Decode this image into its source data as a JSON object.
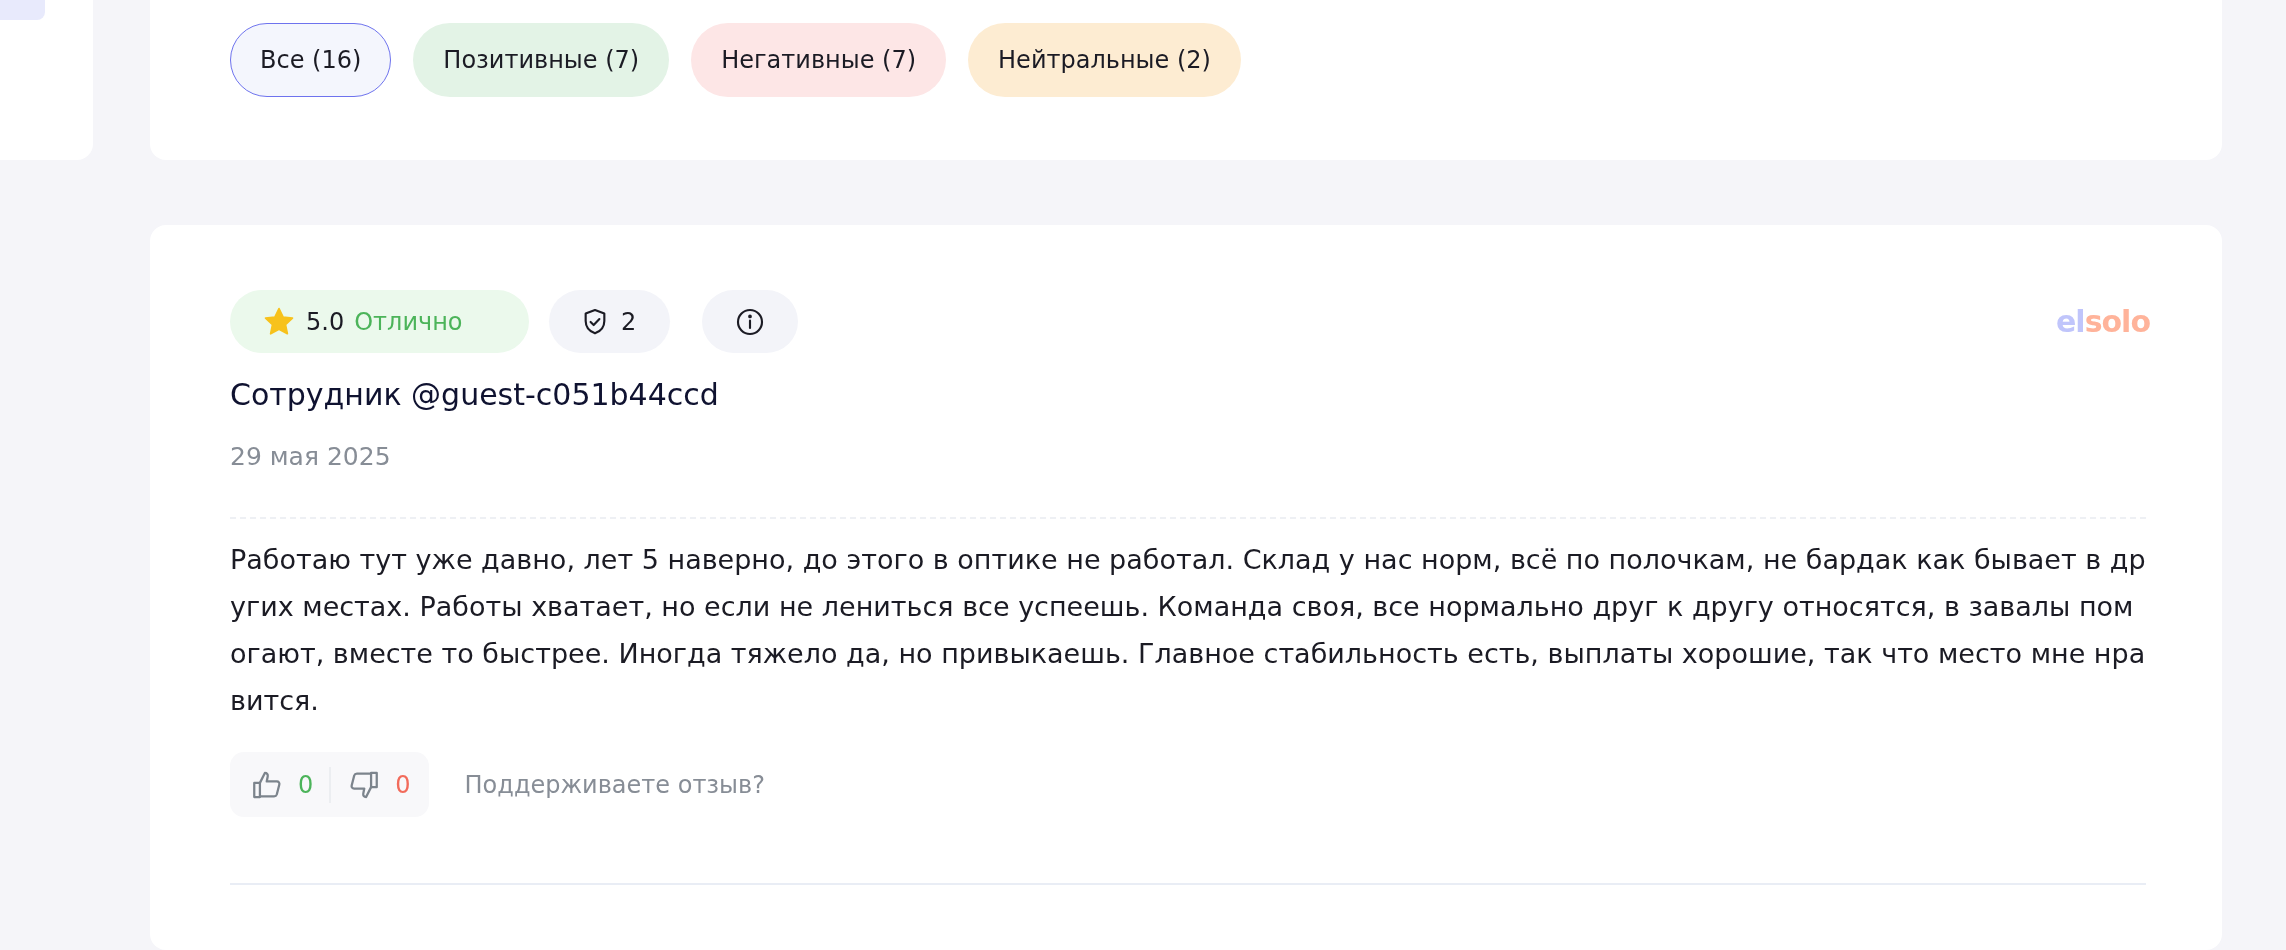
{
  "filters": [
    {
      "label": "Все (16)",
      "kind": "all",
      "selected": true
    },
    {
      "label": "Позитивные (7)",
      "kind": "positive",
      "selected": false
    },
    {
      "label": "Негативные (7)",
      "kind": "negative",
      "selected": false
    },
    {
      "label": "Нейтральные (2)",
      "kind": "neutral",
      "selected": false
    }
  ],
  "review": {
    "rating": "5.0",
    "rating_label": "Отлично",
    "verifications": "2",
    "logo": [
      "el",
      "solo"
    ],
    "author": "Сотрудник @guest-c051b44ccd",
    "date": "29 мая 2025",
    "text": "Работаю тут уже давно, лет 5 наверно, до этого в оптике не работал. Склад у нас норм, всё по полочкам, не бардак как бывает в других местах. Работы хватает, но если не лениться все успеешь. Команда своя, все нормально друг к другу относятся, в завалы помогают, вместе то быстрее. Иногда тяжело да, но привыкаешь. Главное стабильность есть, выплаты хорошие, так что место мне нравится.",
    "likes": "0",
    "dislikes": "0",
    "vote_prompt": "Поддерживаете отзыв?"
  }
}
